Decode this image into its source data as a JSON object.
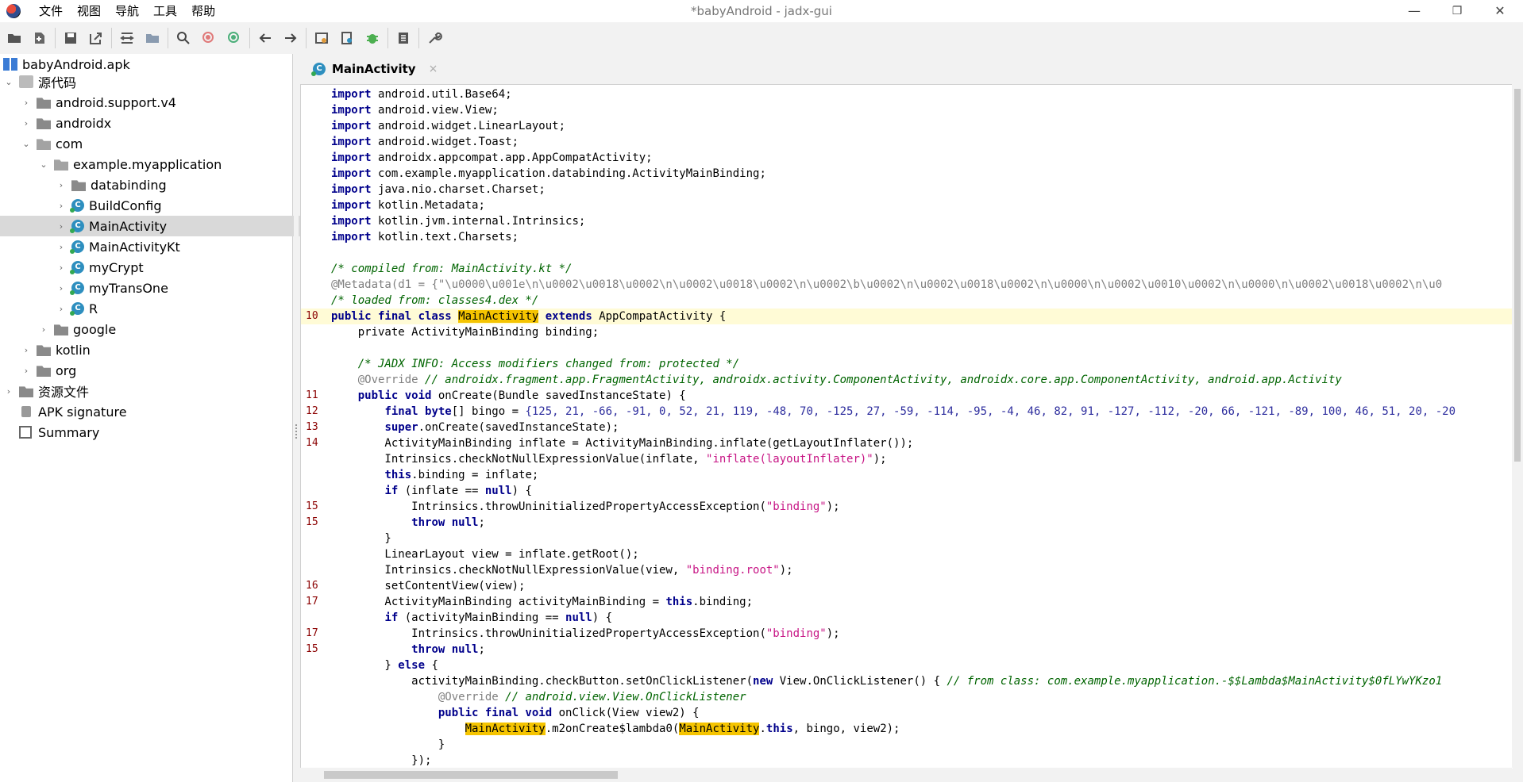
{
  "window": {
    "title": "*babyAndroid - jadx-gui",
    "menu": [
      "文件",
      "视图",
      "导航",
      "工具",
      "帮助"
    ],
    "controls": {
      "minimize": "—",
      "restore": "❐",
      "close": "✕"
    }
  },
  "toolbar": {
    "buttons": [
      "open-file-icon",
      "add-files-icon",
      "save-icon",
      "export-icon",
      "sync-icon",
      "folder-icon",
      "search-icon",
      "search-class-icon",
      "search-usage-icon",
      "back-icon",
      "forward-icon",
      "deobfuscation-icon",
      "quark-icon",
      "debug-icon",
      "log-icon",
      "settings-icon"
    ]
  },
  "tree": {
    "root": "babyAndroid.apk",
    "items": [
      {
        "label": "源代码",
        "type": "pkg-root"
      },
      {
        "label": "android.support.v4",
        "type": "folder"
      },
      {
        "label": "androidx",
        "type": "folder"
      },
      {
        "label": "com",
        "type": "folder-open"
      },
      {
        "label": "example.myapplication",
        "type": "folder-open"
      },
      {
        "label": "databinding",
        "type": "folder"
      },
      {
        "label": "BuildConfig",
        "type": "class"
      },
      {
        "label": "MainActivity",
        "type": "class",
        "selected": true
      },
      {
        "label": "MainActivityKt",
        "type": "class"
      },
      {
        "label": "myCrypt",
        "type": "class"
      },
      {
        "label": "myTransOne",
        "type": "class"
      },
      {
        "label": "R",
        "type": "class"
      },
      {
        "label": "google",
        "type": "folder"
      },
      {
        "label": "kotlin",
        "type": "folder"
      },
      {
        "label": "org",
        "type": "folder"
      },
      {
        "label": "资源文件",
        "type": "folder"
      },
      {
        "label": "APK signature",
        "type": "signature"
      },
      {
        "label": "Summary",
        "type": "summary"
      }
    ]
  },
  "tab": {
    "label": "MainActivity",
    "close": "×"
  },
  "code": {
    "imports": [
      "android.util.Base64",
      "android.view.View",
      "android.widget.LinearLayout",
      "android.widget.Toast",
      "androidx.appcompat.app.AppCompatActivity",
      "com.example.myapplication.databinding.ActivityMainBinding",
      "java.nio.charset.Charset",
      "kotlin.Metadata",
      "kotlin.jvm.internal.Intrinsics",
      "kotlin.text.Charsets"
    ],
    "compiled_from": "/* compiled from: MainActivity.kt */",
    "metadata": "@Metadata(d1 = {\"\\u0000\\u001e\\n\\u0002\\u0018\\u0002\\n\\u0002\\u0018\\u0002\\n\\u0002\\b\\u0002\\n\\u0002\\u0018\\u0002\\n\\u0000\\n\\u0002\\u0010\\u0002\\n\\u0000\\n\\u0002\\u0018\\u0002\\n\\u0",
    "loaded_from": "/* loaded from: classes4.dex */",
    "class_decl_line": "10",
    "binding_field": "private ActivityMainBinding binding;",
    "jadx_info": "/* JADX INFO: Access modifiers changed from: protected */",
    "override_comment": "// androidx.fragment.app.FragmentActivity, androidx.activity.ComponentActivity, androidx.core.app.ComponentActivity, android.app.Activity",
    "bingo": "{125, 21, -66, -91, 0, 52, 21, 119, -48, 70, -125, 27, -59, -114, -95, -4, 46, 82, 91, -127, -112, -20, 66, -121, -89, 100, 46, 51, 20, -20",
    "line_numbers": [
      "11",
      "12",
      "13",
      "14",
      "15",
      "15",
      "16",
      "17",
      "17",
      "15"
    ],
    "inflate_msg": "\"inflate(layoutInflater)\"",
    "binding_msg": "\"binding\"",
    "root_msg": "\"binding.root\"",
    "lambda_comment": "// from class: com.example.myapplication.-$$Lambda$MainActivity$0fLYwYKzo1",
    "onclick_comment": "// android.view.View.OnClickListener"
  }
}
